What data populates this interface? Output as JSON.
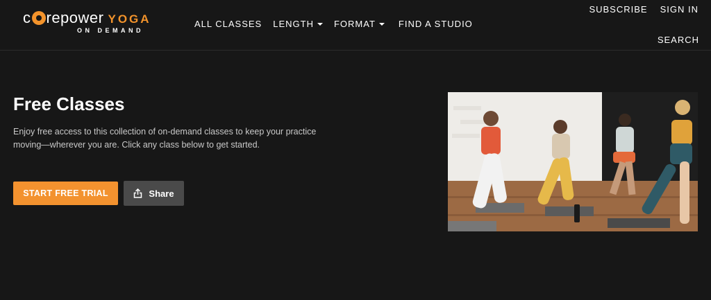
{
  "logo": {
    "text_pre": "c",
    "text_post": "repower",
    "text_yoga": "YOGA",
    "text_sub": "ON DEMAND"
  },
  "nav": {
    "all_classes": "ALL CLASSES",
    "length": "LENGTH",
    "format": "FORMAT",
    "find_studio": "FIND A STUDIO"
  },
  "account": {
    "subscribe": "SUBSCRIBE",
    "sign_in": "SIGN IN",
    "search": "SEARCH"
  },
  "hero": {
    "title": "Free Classes",
    "description": "Enjoy free access to this collection of on-demand classes to keep your practice moving—wherever you are. Click any class below to get started.",
    "cta_label": "START FREE TRIAL",
    "share_label": "Share",
    "image_icon": "yoga-class-photo"
  },
  "colors": {
    "background": "#171717",
    "accent": "#f3922f",
    "share_button": "#4a4a4a",
    "body_text": "#c9c9c9"
  },
  "icons": {
    "share": "share-icon",
    "dropdown": "chevron-down-icon"
  }
}
